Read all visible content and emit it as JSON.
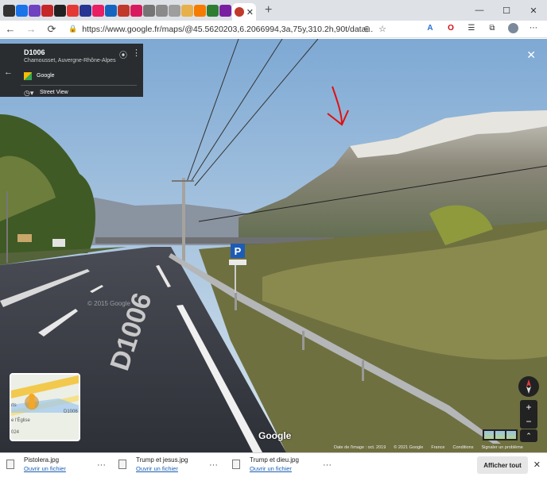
{
  "browser": {
    "tabs_count": 34,
    "active_tab_close": "✕",
    "new_tab": "+",
    "window_controls": [
      "—",
      "☐",
      "✕"
    ],
    "nav": {
      "back": "←",
      "forward": "→",
      "reload": "⟳"
    },
    "url": "https://www.google.fr/maps/@45.5620203,6.2066994,3a,75y,310.2h,90t/data...",
    "omni_icons": [
      "⊕",
      "☆"
    ],
    "extension_icons": [
      "translate-icon",
      "opera-icon",
      "favorites-icon",
      "collections-icon",
      "profile-icon",
      "menu-icon"
    ],
    "colors": {
      "tabstrip": "#dee1e6",
      "accent": "#c0392b"
    }
  },
  "streetview": {
    "card": {
      "road": "D1006",
      "place": "Chamousset, Auvergne-Rhône-Alpes",
      "provider": "Google",
      "street_view_label": "Street View",
      "back": "←"
    },
    "close": "✕",
    "road_marking": "D1006",
    "parking_sign": "P",
    "watermark": "© 2015 Google",
    "logo": "Google",
    "footer": [
      "Date de l'image : oct. 2019",
      "© 2021 Google",
      "France",
      "Conditions",
      "Signaler un problème"
    ],
    "minimap": {
      "labels": [
        "rts",
        "D1006",
        "e l'Église",
        "024"
      ]
    },
    "zoom": {
      "in": "+",
      "out": "−"
    },
    "expand": "⌃"
  },
  "downloads": {
    "items": [
      {
        "name": "Pistolera.jpg",
        "action": "Ouvrir un fichier"
      },
      {
        "name": "Trump et jesus.jpg",
        "action": "Ouvrir un fichier"
      },
      {
        "name": "Trump et dieu.jpg",
        "action": "Ouvrir un fichier"
      }
    ],
    "more": "···",
    "show_all": "Afficher tout",
    "close": "✕"
  }
}
